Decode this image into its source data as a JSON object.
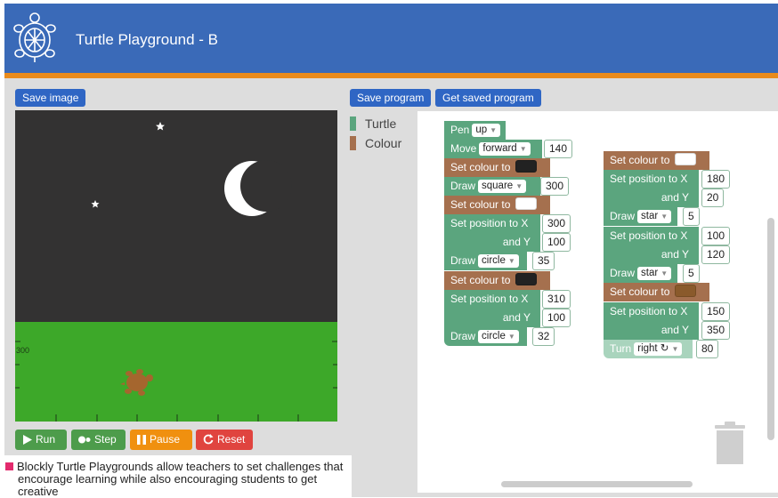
{
  "header": {
    "title": "Turtle Playground - B"
  },
  "toolbar": {
    "save_image": "Save image",
    "save_program": "Save program",
    "get_saved_program": "Get saved program"
  },
  "canvas": {
    "axis_label": "300"
  },
  "controls": {
    "run": "Run",
    "step": "Step",
    "pause": "Pause",
    "reset": "Reset"
  },
  "toolbox": [
    {
      "label": "Turtle",
      "color": "#5ba57e"
    },
    {
      "label": "Colour",
      "color": "#a5704e"
    }
  ],
  "blocks": {
    "pen": "Pen",
    "pen_value": "up",
    "move": "Move",
    "move_dir": "forward",
    "move_amount": "140",
    "set_colour": "Set colour to",
    "draw": "Draw",
    "draw_shape_1": "square",
    "draw_size_1": "300",
    "set_pos": "Set position to X",
    "and_y": "and Y",
    "pos1_x": "300",
    "pos1_y": "100",
    "draw_shape_2": "circle",
    "draw_size_2": "35",
    "pos2_x": "310",
    "pos2_y": "100",
    "draw_shape_3": "circle",
    "draw_size_3": "32",
    "pos3_x": "180",
    "pos3_y": "20",
    "draw_shape_4": "star",
    "draw_size_4": "5",
    "pos4_x": "100",
    "pos4_y": "120",
    "draw_shape_5": "star",
    "draw_size_5": "5",
    "pos5_x": "150",
    "pos5_y": "350",
    "turn": "Turn",
    "turn_dir": "right ↻",
    "turn_amount": "80"
  },
  "colors": {
    "black_swatch": "#222222",
    "white_swatch": "#ffffff",
    "brown_swatch": "#8a5a2b"
  },
  "caption": {
    "line1": "Blockly Turtle Playgrounds allow teachers to set challenges that",
    "line2": "encourage learning while also encouraging students to get creative"
  }
}
